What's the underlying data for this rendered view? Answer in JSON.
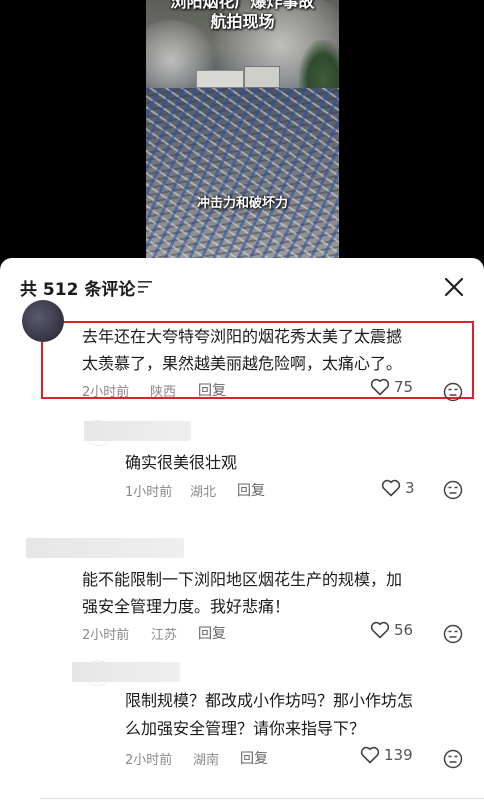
{
  "video": {
    "title_line1": "浏阳烟花厂爆炸事故",
    "title_line2": "航拍现场",
    "caption": "冲击力和破坏力"
  },
  "header": {
    "comment_count": "共 512 条评论",
    "sort_icon": "sort-icon",
    "close_icon": "close-icon"
  },
  "comments": [
    {
      "line1": "去年还在大夸特夸浏阳的烟花秀太美了太震撼",
      "line2": "太羡慕了，果然越美丽越危险啊，太痛心了。",
      "time": "2小时前",
      "location": "陕西",
      "reply_label": "回复",
      "likes": "75"
    },
    {
      "line1": "确实很美很壮观",
      "time": "1小时前",
      "location": "湖北",
      "reply_label": "回复",
      "likes": "3"
    },
    {
      "line1": "能不能限制一下浏阳地区烟花生产的规模，加",
      "line2": "强安全管理力度。我好悲痛！",
      "time": "2小时前",
      "location": "江苏",
      "reply_label": "回复",
      "likes": "56"
    },
    {
      "line1": "限制规模？都改成小作坊吗？那小作坊怎",
      "line2": "么加强安全管理？请你来指导下？",
      "time": "2小时前",
      "location": "湖南",
      "reply_label": "回复",
      "likes": "139"
    }
  ],
  "colors": {
    "highlight_border": "#e0202a",
    "meta_text": "#8a8a8a"
  }
}
